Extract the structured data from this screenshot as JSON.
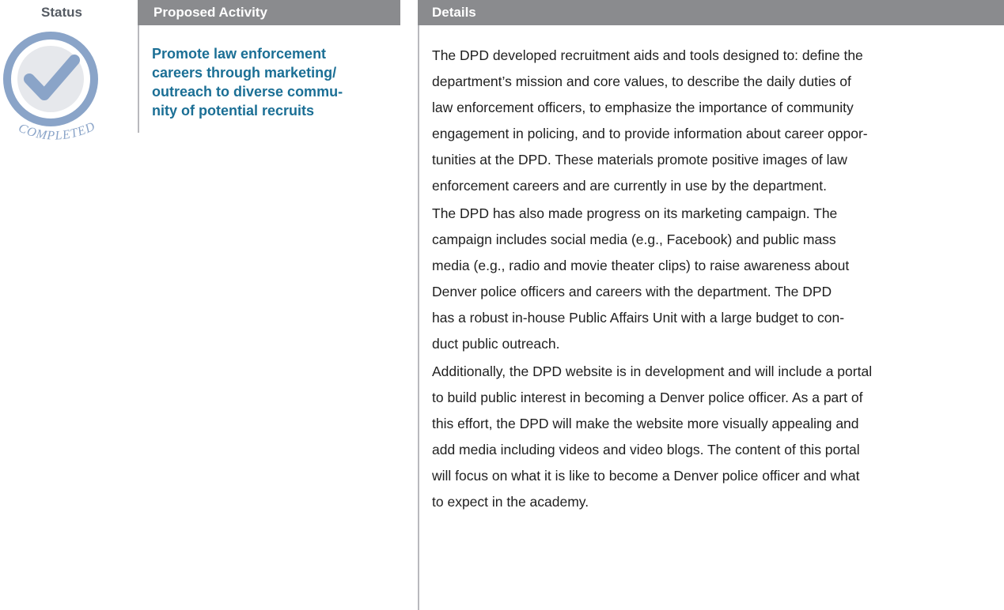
{
  "header": {
    "status": "Status",
    "activity": "Proposed Activity",
    "details": "Details"
  },
  "status": {
    "badge_text": "COMPLETED",
    "icon": "checkmark-icon",
    "color": "#8aa4c8"
  },
  "activity": {
    "lines": [
      "Promote law enforcement",
      "careers through marketing/",
      "outreach to diverse commu-",
      "nity of potential recruits"
    ],
    "color": "#1b6f95"
  },
  "details": {
    "paragraphs": [
      [
        "The DPD developed recruitment aids and tools designed to: define the",
        "department’s mission and core values, to describe the daily duties of",
        "law enforcement officers, to emphasize the importance of community",
        "engagement in policing, and to provide information about career oppor-",
        "tunities at the DPD. These materials promote positive images of law",
        "enforcement careers and are currently in use by the department."
      ],
      [
        "The DPD has also made progress on its marketing campaign. The",
        "campaign includes social media (e.g., Facebook) and public mass",
        "media (e.g., radio and movie theater clips) to raise awareness about",
        "Denver police officers and careers with the department. The DPD",
        "has a robust in-house Public Affairs Unit with a large budget to con-",
        "duct public outreach."
      ],
      [
        "Additionally, the DPD website is in development and will include a portal",
        "to build public interest in becoming a Denver police officer. As a part of",
        "this effort, the DPD will make the website more visually appealing and",
        "add media including videos and video blogs. The content of this portal",
        "will focus on what it is like to become a Denver police officer and what",
        "to expect in the academy."
      ]
    ]
  }
}
